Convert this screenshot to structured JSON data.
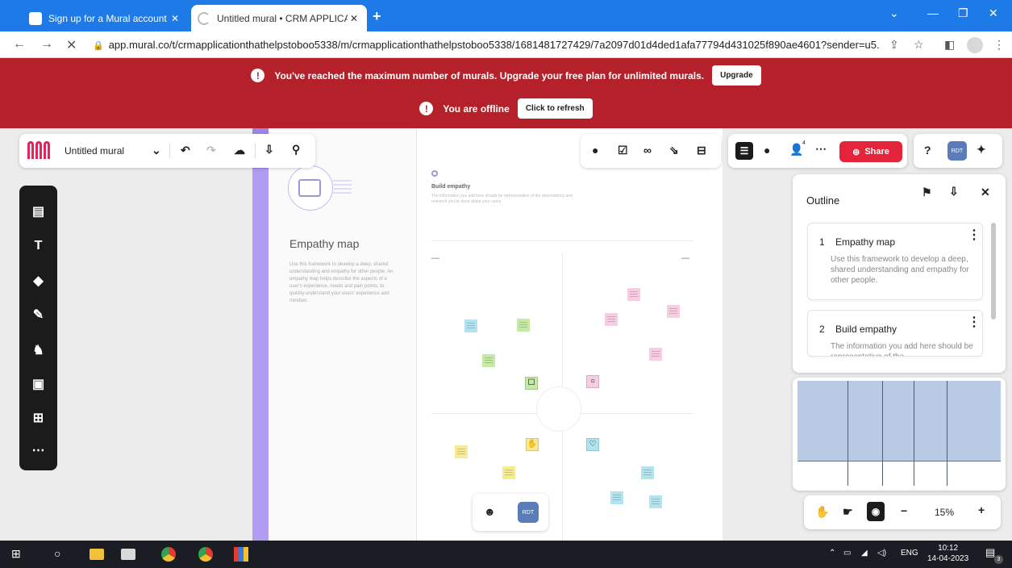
{
  "browser": {
    "tabs": [
      {
        "title": "Sign up for a Mural account | MU",
        "active": false
      },
      {
        "title": "Untitled mural • CRM APPLICATIO",
        "active": true
      }
    ],
    "url": "app.mural.co/t/crmapplicationthathelpstoboo5338/m/crmapplicationthathelpstoboo5338/1681481727429/7a2097d01d4ded1afa77794d431025f890ae4601?sender=u5..."
  },
  "banner": {
    "limit_message": "You've reached the maximum number of murals. Upgrade your free plan for unlimited murals.",
    "upgrade_label": "Upgrade",
    "offline_message": "You are offline",
    "refresh_label": "Click to refresh"
  },
  "toolbar": {
    "mural_title": "Untitled mural",
    "share_label": "Share",
    "collaborator_count": "4",
    "avatar_initials": "RDT"
  },
  "canvas": {
    "frame_title": "Empathy map",
    "frame_description": "Use this framework to develop a deep, shared understanding and empathy for other people. An empathy map helps describe the aspects of a user's experience, needs and pain points, to quickly understand your users' experience and mindset.",
    "section_title": "Build empathy",
    "section_description": "The information you add here should be representative of the observations and research you've done about your users."
  },
  "outline": {
    "title": "Outline",
    "items": [
      {
        "number": "1",
        "name": "Empathy map",
        "description": "Use this framework to develop a deep, shared understanding and empathy for other people."
      },
      {
        "number": "2",
        "name": "Build empathy",
        "description": "The information you add here should be representative of the"
      }
    ]
  },
  "zoom": {
    "value": "15%"
  },
  "taskbar": {
    "time": "10:12",
    "date": "14-04-2023",
    "language": "ENG",
    "notifications": "3"
  },
  "colors": {
    "banner": "#b5212a",
    "share": "#e3243a",
    "tab_bar": "#1e7ae6",
    "frame_accent": "#b29cf2"
  }
}
